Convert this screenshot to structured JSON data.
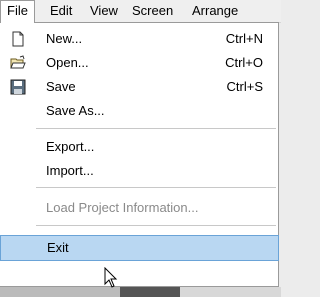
{
  "menubar": {
    "items": [
      {
        "label": "File"
      },
      {
        "label": "Edit"
      },
      {
        "label": "View"
      },
      {
        "label": "Screen"
      },
      {
        "label": "Arrange"
      }
    ]
  },
  "file_menu": {
    "items": [
      {
        "label": "New...",
        "shortcut": "Ctrl+N",
        "icon": "new-file-icon"
      },
      {
        "label": "Open...",
        "shortcut": "Ctrl+O",
        "icon": "open-folder-icon"
      },
      {
        "label": "Save",
        "shortcut": "Ctrl+S",
        "icon": "save-icon"
      },
      {
        "label": "Save As..."
      },
      {
        "label": "Export..."
      },
      {
        "label": "Import..."
      },
      {
        "label": "Load Project Information...",
        "disabled": true
      },
      {
        "label": "Exit",
        "highlighted": true
      }
    ]
  },
  "colors": {
    "highlight_bg": "#b9d7f2",
    "highlight_border": "#6aa3d7",
    "disabled_text": "#8a8a8a"
  }
}
